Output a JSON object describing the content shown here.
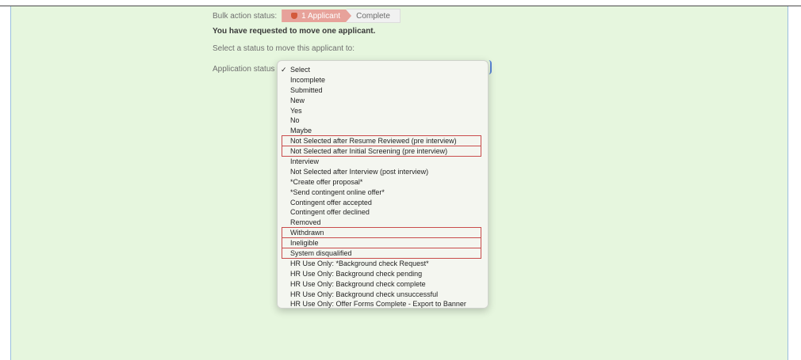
{
  "bulk_action": {
    "label": "Bulk action status:",
    "applicant_step": "1 Applicant",
    "complete_step": "Complete"
  },
  "heading": "You have requested to move one applicant.",
  "instruction": "Select a status to move this applicant to:",
  "field_label": "Application status",
  "selected_option": "Select",
  "options": [
    "Select",
    "Incomplete",
    "Submitted",
    "New",
    "Yes",
    "No",
    "Maybe",
    "Not Selected after Resume Reviewed (pre interview)",
    "Not Selected after Initial Screening (pre interview)",
    "Interview",
    "Not Selected after Interview (post interview)",
    "*Create offer proposal*",
    "*Send contingent online offer*",
    "Contingent offer accepted",
    "Contingent offer declined",
    "Removed",
    "Withdrawn",
    "Ineligible",
    "System disqualified",
    "HR Use Only: *Background check Request*",
    "HR Use Only: Background check pending",
    "HR Use Only: Background check complete",
    "HR Use Only: Background check unsuccessful",
    "HR Use Only: Offer Forms Complete - Export to Banner"
  ],
  "highlighted_options": [
    "Not Selected after Resume Reviewed (pre interview)",
    "Not Selected after Initial Screening (pre interview)",
    "Withdrawn",
    "Ineligible",
    "System disqualified"
  ],
  "colors": {
    "panel_background": "#e6f6de",
    "applicant_step": "#e7a29a",
    "highlight_box": "#c94c4c"
  }
}
